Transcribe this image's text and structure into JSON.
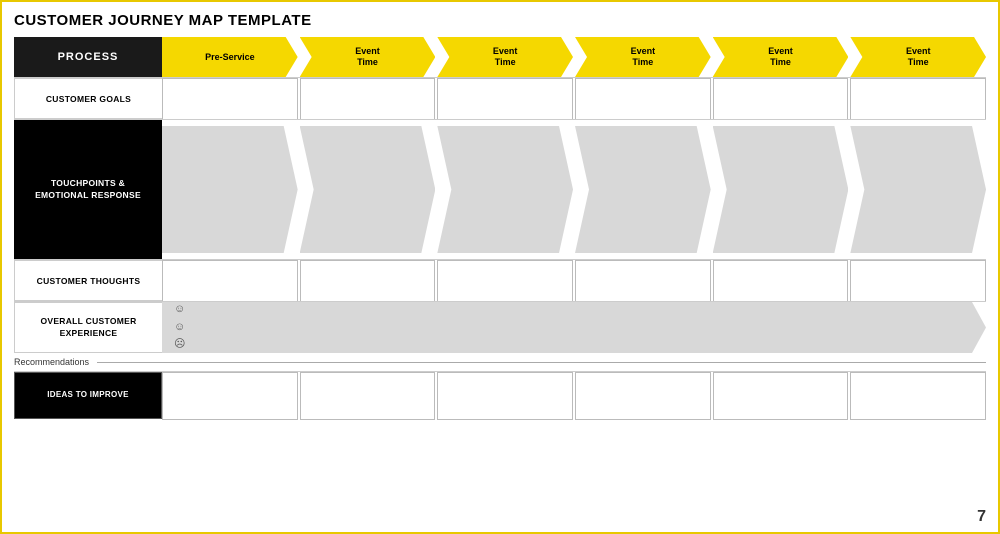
{
  "title": "CUSTOMER JOURNEY MAP TEMPLATE",
  "rows": {
    "process": "PROCESS",
    "pre_service": "Pre-Service",
    "event_time": "Event\nTime",
    "customer_goals": "CUSTOMER GOALS",
    "touchpoints": "TOUCHPOINTS &\nEMOTIONAL RESPONSE",
    "customer_thoughts": "CUSTOMER THOUGHTS",
    "overall_experience": "OVERALL CUSTOMER\nEXPERIENCE",
    "recommendations": "Recommendations",
    "ideas": "IDEAS TO IMPROVE"
  },
  "emojis": [
    "☺",
    "☺",
    "☹"
  ],
  "event_columns": 5,
  "page_number": "7"
}
